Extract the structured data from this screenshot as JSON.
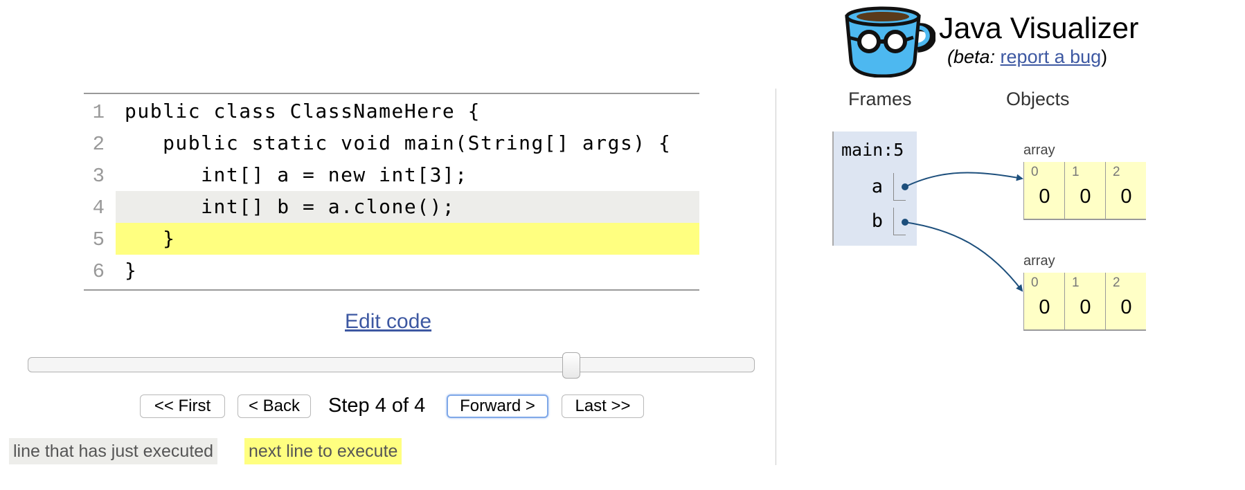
{
  "header": {
    "logo_icon": "visualizer-mug-icon",
    "title": "Java Visualizer",
    "beta_label": "(beta: ",
    "bug_link": "report a bug",
    "close_paren": ")"
  },
  "code": {
    "lines": [
      {
        "number": "1",
        "text": "public class ClassNameHere {",
        "state": "none"
      },
      {
        "number": "2",
        "text": "   public static void main(String[] args) {",
        "state": "none"
      },
      {
        "number": "3",
        "text": "      int[] a = new int[3];",
        "state": "none"
      },
      {
        "number": "4",
        "text": "      int[] b = a.clone();",
        "state": "just-executed"
      },
      {
        "number": "5",
        "text": "   }",
        "state": "next-to-execute"
      },
      {
        "number": "6",
        "text": "}",
        "state": "none"
      }
    ]
  },
  "edit_code_link": "Edit code",
  "slider": {
    "current_step": 4,
    "total_steps": 4
  },
  "nav": {
    "first": "<< First",
    "back": "< Back",
    "step_label": "Step 4 of 4",
    "forward": "Forward >",
    "last": "Last >>"
  },
  "legend": {
    "just_executed": "line that has just executed",
    "next_line": "next line to execute"
  },
  "colors": {
    "just_executed_bg": "#ededea",
    "next_line_bg": "#ffff80",
    "frame_bg": "#dde5f2",
    "array_cell_bg": "#ffffc6",
    "link": "#3D58A2",
    "pointer": "#1d4f7c"
  },
  "viz": {
    "frames_header": "Frames",
    "objects_header": "Objects",
    "frame": {
      "name": "main:5",
      "vars": [
        {
          "name": "a",
          "points_to": "array-1"
        },
        {
          "name": "b",
          "points_to": "array-2"
        }
      ]
    },
    "objects": [
      {
        "id": "array-1",
        "label": "array",
        "indices": [
          "0",
          "1",
          "2"
        ],
        "values": [
          "0",
          "0",
          "0"
        ]
      },
      {
        "id": "array-2",
        "label": "array",
        "indices": [
          "0",
          "1",
          "2"
        ],
        "values": [
          "0",
          "0",
          "0"
        ]
      }
    ]
  }
}
